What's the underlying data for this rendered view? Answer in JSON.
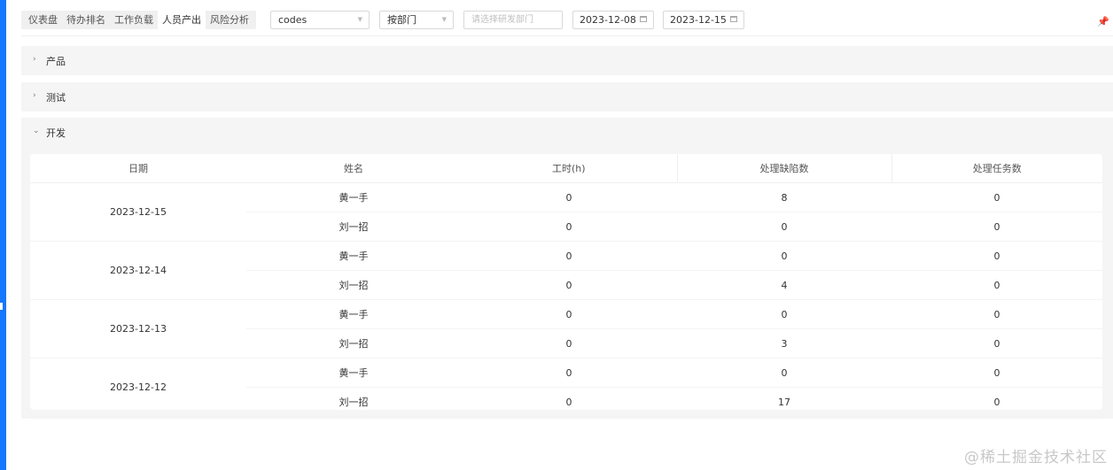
{
  "tabs": [
    {
      "label": "仪表盘"
    },
    {
      "label": "待办排名"
    },
    {
      "label": "工作负载"
    },
    {
      "label": "人员产出"
    },
    {
      "label": "风险分析"
    }
  ],
  "filters": {
    "project": "codes",
    "group_by": "按部门",
    "department_placeholder": "请选择研发部门",
    "start_date": "2023-12-08",
    "end_date": "2023-12-15"
  },
  "panels": {
    "product": {
      "title": "产品",
      "caret": "›"
    },
    "test": {
      "title": "测试",
      "caret": "›"
    },
    "dev": {
      "title": "开发",
      "caret": "⌄"
    }
  },
  "table": {
    "columns": [
      "日期",
      "姓名",
      "工时(h)",
      "处理缺陷数",
      "处理任务数"
    ],
    "groups": [
      {
        "date": "2023-12-15",
        "rows": [
          {
            "name": "黄一手",
            "hours": "0",
            "defects": "8",
            "tasks": "0"
          },
          {
            "name": "刘一招",
            "hours": "0",
            "defects": "0",
            "tasks": "0"
          }
        ]
      },
      {
        "date": "2023-12-14",
        "rows": [
          {
            "name": "黄一手",
            "hours": "0",
            "defects": "0",
            "tasks": "0"
          },
          {
            "name": "刘一招",
            "hours": "0",
            "defects": "4",
            "tasks": "0"
          }
        ]
      },
      {
        "date": "2023-12-13",
        "rows": [
          {
            "name": "黄一手",
            "hours": "0",
            "defects": "0",
            "tasks": "0"
          },
          {
            "name": "刘一招",
            "hours": "0",
            "defects": "3",
            "tasks": "0"
          }
        ]
      },
      {
        "date": "2023-12-12",
        "rows": [
          {
            "name": "黄一手",
            "hours": "0",
            "defects": "0",
            "tasks": "0"
          },
          {
            "name": "刘一招",
            "hours": "0",
            "defects": "17",
            "tasks": "0"
          }
        ]
      }
    ]
  },
  "watermark": "@稀土掘金技术社区",
  "icons": {
    "pin": "pin-icon",
    "calendar": "calendar-icon",
    "dropdown": "chevron-down-icon"
  },
  "colors": {
    "accent": "#1677ff",
    "panel_bg": "#f5f5f5"
  }
}
